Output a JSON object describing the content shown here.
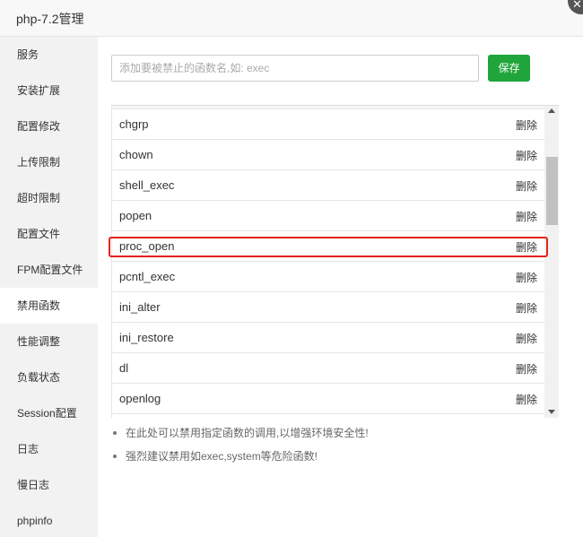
{
  "window": {
    "title": "php-7.2管理",
    "close_icon": "close-icon"
  },
  "sidebar": {
    "items": [
      {
        "label": "服务"
      },
      {
        "label": "安装扩展"
      },
      {
        "label": "配置修改"
      },
      {
        "label": "上传限制"
      },
      {
        "label": "超时限制"
      },
      {
        "label": "配置文件"
      },
      {
        "label": "FPM配置文件"
      },
      {
        "label": "禁用函数",
        "active": true
      },
      {
        "label": "性能调整"
      },
      {
        "label": "负载状态"
      },
      {
        "label": "Session配置"
      },
      {
        "label": "日志"
      },
      {
        "label": "慢日志"
      },
      {
        "label": "phpinfo"
      }
    ]
  },
  "form": {
    "input_placeholder": "添加要被禁止的函数名,如: exec",
    "input_value": "",
    "save_label": "保存"
  },
  "table": {
    "delete_label": "删除",
    "rows": [
      {
        "name": "chgrp"
      },
      {
        "name": "chown"
      },
      {
        "name": "shell_exec"
      },
      {
        "name": "popen"
      },
      {
        "name": "proc_open",
        "highlighted": true
      },
      {
        "name": "pcntl_exec"
      },
      {
        "name": "ini_alter"
      },
      {
        "name": "ini_restore"
      },
      {
        "name": "dl"
      },
      {
        "name": "openlog"
      }
    ]
  },
  "tips": [
    "在此处可以禁用指定函数的调用,以增强环境安全性!",
    "强烈建议禁用如exec,system等危险函数!"
  ],
  "colors": {
    "accent": "#20a53a",
    "highlight_border": "#e0241b",
    "sidebar_bg": "#f2f2f2"
  }
}
